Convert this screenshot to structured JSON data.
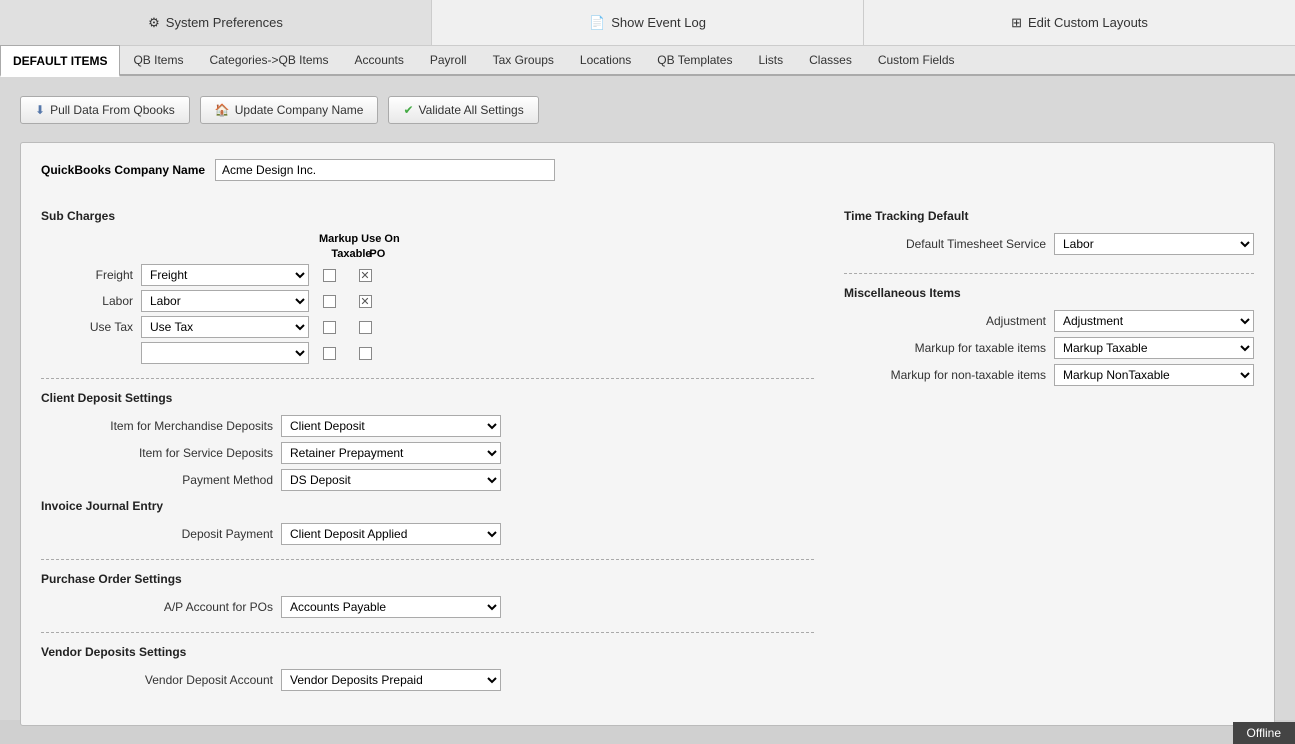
{
  "topNav": {
    "preferences": {
      "label": "System Preferences",
      "icon": "⚙"
    },
    "eventLog": {
      "label": "Show Event Log",
      "icon": "📄"
    },
    "customLayouts": {
      "label": "Edit Custom Layouts",
      "icon": "⊞"
    }
  },
  "tabs": [
    {
      "id": "default-items",
      "label": "DEFAULT ITEMS",
      "active": true
    },
    {
      "id": "qb-items",
      "label": "QB Items"
    },
    {
      "id": "categories-qb",
      "label": "Categories->QB Items"
    },
    {
      "id": "accounts",
      "label": "Accounts"
    },
    {
      "id": "payroll",
      "label": "Payroll"
    },
    {
      "id": "tax-groups",
      "label": "Tax Groups"
    },
    {
      "id": "locations",
      "label": "Locations"
    },
    {
      "id": "qb-templates",
      "label": "QB Templates"
    },
    {
      "id": "lists",
      "label": "Lists"
    },
    {
      "id": "classes",
      "label": "Classes"
    },
    {
      "id": "custom-fields",
      "label": "Custom Fields"
    }
  ],
  "buttons": {
    "pullData": "Pull Data From Qbooks",
    "updateCompany": "Update Company Name",
    "validateSettings": "Validate All Settings"
  },
  "companyName": {
    "label": "QuickBooks Company Name",
    "value": "Acme Design Inc."
  },
  "subCharges": {
    "heading": "Sub Charges",
    "markupHeader": "Markup Use On",
    "taxableCol": "Taxable",
    "poCol": "PO",
    "rows": [
      {
        "label": "Freight",
        "value": "Freight",
        "taxable": false,
        "po": true
      },
      {
        "label": "Labor",
        "value": "Labor",
        "taxable": false,
        "po": true
      },
      {
        "label": "Use Tax",
        "value": "Use Tax",
        "taxable": false,
        "po": false
      },
      {
        "label": "",
        "value": "",
        "taxable": false,
        "po": false
      }
    ]
  },
  "clientDeposit": {
    "heading": "Client Deposit Settings",
    "merchandiseLabel": "Item for Merchandise Deposits",
    "merchandiseValue": "Client Deposit",
    "serviceLabel": "Item for Service Deposits",
    "serviceValue": "Retainer Prepayment",
    "paymentMethodLabel": "Payment Method",
    "paymentMethodValue": "DS Deposit",
    "invoiceJournalHeading": "Invoice Journal Entry",
    "depositPaymentLabel": "Deposit Payment",
    "depositPaymentValue": "Client Deposit Applied"
  },
  "purchaseOrder": {
    "heading": "Purchase Order Settings",
    "apAccountLabel": "A/P Account for POs",
    "apAccountValue": "Accounts Payable"
  },
  "vendorDeposits": {
    "heading": "Vendor Deposits Settings",
    "accountLabel": "Vendor Deposit Account",
    "accountValue": "Vendor Deposits Prepaid"
  },
  "timeTracking": {
    "heading": "Time Tracking Default",
    "defaultServiceLabel": "Default Timesheet Service",
    "defaultServiceValue": "Labor"
  },
  "miscItems": {
    "heading": "Miscellaneous Items",
    "adjustmentLabel": "Adjustment",
    "adjustmentValue": "Adjustment",
    "markupTaxableLabel": "Markup for taxable items",
    "markupTaxableValue": "Markup Taxable",
    "markupNonTaxableLabel": "Markup for non-taxable items",
    "markupNonTaxableValue": "Markup NonTaxable"
  },
  "offline": "Offline"
}
